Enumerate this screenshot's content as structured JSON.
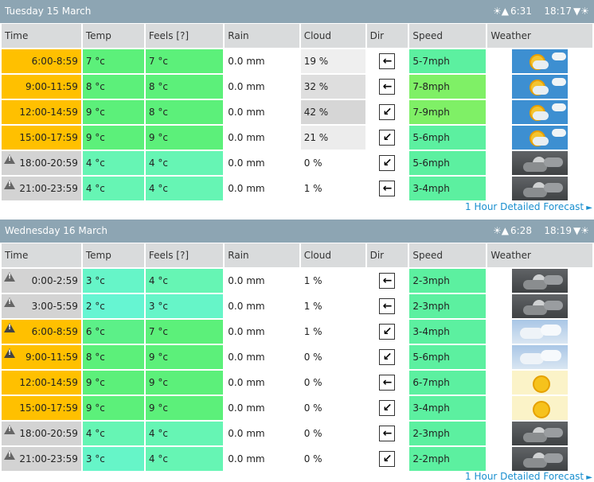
{
  "colors": {
    "header_bg": "#8da5b3",
    "time_orange": "#ffc000",
    "time_grey": "#d3d3d3",
    "temp_green_mid": "#5cf07a",
    "temp_green_light": "#66f0a8",
    "temp_teal": "#66f5c8",
    "cloud_light": "#eeeeee",
    "cloud_mid": "#dcdcdc",
    "speed_green": "#5cf0a0",
    "speed_lime": "#7ff066",
    "link_blue": "#1a8fcf"
  },
  "columns": [
    "Time",
    "Temp",
    "Feels [?]",
    "Rain",
    "Cloud",
    "Dir",
    "Speed",
    "Weather"
  ],
  "link_text": "1 Hour Detailed Forecast",
  "days": [
    {
      "title": "Tuesday 15 March",
      "sunrise": "6:31",
      "sunset": "18:17",
      "rows": [
        {
          "time": "6:00-8:59",
          "time_style": "orange",
          "warn": false,
          "temp": "7 °c",
          "temp_color": "#5cf07a",
          "feels": "7 °c",
          "feels_color": "#5cf07a",
          "rain": "0.0 mm",
          "cloud": "19 %",
          "cloud_color": "#efefef",
          "dir": "←",
          "speed": "5-7mph",
          "speed_color": "#5cf0a0",
          "weather": "sunny-cloud"
        },
        {
          "time": "9:00-11:59",
          "time_style": "orange",
          "warn": false,
          "temp": "8 °c",
          "temp_color": "#5cf07a",
          "feels": "8 °c",
          "feels_color": "#5cf07a",
          "rain": "0.0 mm",
          "cloud": "32 %",
          "cloud_color": "#dedede",
          "dir": "←",
          "speed": "7-8mph",
          "speed_color": "#7ff066",
          "weather": "sunny-cloud"
        },
        {
          "time": "12:00-14:59",
          "time_style": "orange",
          "warn": false,
          "temp": "9 °c",
          "temp_color": "#5cf07a",
          "feels": "8 °c",
          "feels_color": "#5cf07a",
          "rain": "0.0 mm",
          "cloud": "42 %",
          "cloud_color": "#d6d6d6",
          "dir": "↙",
          "speed": "7-9mph",
          "speed_color": "#7ff066",
          "weather": "sunny-cloud"
        },
        {
          "time": "15:00-17:59",
          "time_style": "orange",
          "warn": false,
          "temp": "9 °c",
          "temp_color": "#5cf07a",
          "feels": "9 °c",
          "feels_color": "#5cf07a",
          "rain": "0.0 mm",
          "cloud": "21 %",
          "cloud_color": "#ececec",
          "dir": "↙",
          "speed": "5-6mph",
          "speed_color": "#5cf0a0",
          "weather": "sunny-cloud"
        },
        {
          "time": "18:00-20:59",
          "time_style": "grey",
          "warn": true,
          "temp": "4 °c",
          "temp_color": "#66f5b4",
          "feels": "4 °c",
          "feels_color": "#66f5b4",
          "rain": "0.0 mm",
          "cloud": "0 %",
          "cloud_color": "#ffffff",
          "dir": "↙",
          "speed": "5-6mph",
          "speed_color": "#5cf0a0",
          "weather": "night-cloud"
        },
        {
          "time": "21:00-23:59",
          "time_style": "grey",
          "warn": true,
          "temp": "4 °c",
          "temp_color": "#66f5b4",
          "feels": "4 °c",
          "feels_color": "#66f5b4",
          "rain": "0.0 mm",
          "cloud": "1 %",
          "cloud_color": "#ffffff",
          "dir": "←",
          "speed": "3-4mph",
          "speed_color": "#5cf0a0",
          "weather": "night-cloud"
        }
      ]
    },
    {
      "title": "Wednesday 16 March",
      "sunrise": "6:28",
      "sunset": "18:19",
      "rows": [
        {
          "time": "0:00-2:59",
          "time_style": "grey",
          "warn": true,
          "temp": "3 °c",
          "temp_color": "#66f5c8",
          "feels": "4 °c",
          "feels_color": "#66f5b4",
          "rain": "0.0 mm",
          "cloud": "1 %",
          "cloud_color": "#ffffff",
          "dir": "←",
          "speed": "2-3mph",
          "speed_color": "#5cf0a0",
          "weather": "night-cloud"
        },
        {
          "time": "3:00-5:59",
          "time_style": "grey",
          "warn": true,
          "temp": "2 °c",
          "temp_color": "#66f5d2",
          "feels": "3 °c",
          "feels_color": "#66f5c8",
          "rain": "0.0 mm",
          "cloud": "1 %",
          "cloud_color": "#ffffff",
          "dir": "←",
          "speed": "2-3mph",
          "speed_color": "#5cf0a0",
          "weather": "night-cloud"
        },
        {
          "time": "6:00-8:59",
          "time_style": "orange",
          "warn": true,
          "temp": "6 °c",
          "temp_color": "#5cf088",
          "feels": "7 °c",
          "feels_color": "#5cf07a",
          "rain": "0.0 mm",
          "cloud": "1 %",
          "cloud_color": "#ffffff",
          "dir": "↙",
          "speed": "3-4mph",
          "speed_color": "#5cf0a0",
          "weather": "cloudy"
        },
        {
          "time": "9:00-11:59",
          "time_style": "orange",
          "warn": true,
          "temp": "8 °c",
          "temp_color": "#5cf07a",
          "feels": "9 °c",
          "feels_color": "#5cf07a",
          "rain": "0.0 mm",
          "cloud": "0 %",
          "cloud_color": "#ffffff",
          "dir": "↙",
          "speed": "5-6mph",
          "speed_color": "#5cf0a0",
          "weather": "cloudy"
        },
        {
          "time": "12:00-14:59",
          "time_style": "orange",
          "warn": false,
          "temp": "9 °c",
          "temp_color": "#5cf07a",
          "feels": "9 °c",
          "feels_color": "#5cf07a",
          "rain": "0.0 mm",
          "cloud": "0 %",
          "cloud_color": "#ffffff",
          "dir": "←",
          "speed": "6-7mph",
          "speed_color": "#5cf0a0",
          "weather": "sun"
        },
        {
          "time": "15:00-17:59",
          "time_style": "orange",
          "warn": false,
          "temp": "9 °c",
          "temp_color": "#5cf07a",
          "feels": "9 °c",
          "feels_color": "#5cf07a",
          "rain": "0.0 mm",
          "cloud": "0 %",
          "cloud_color": "#ffffff",
          "dir": "↙",
          "speed": "3-4mph",
          "speed_color": "#5cf0a0",
          "weather": "sun"
        },
        {
          "time": "18:00-20:59",
          "time_style": "grey",
          "warn": true,
          "temp": "4 °c",
          "temp_color": "#66f5b4",
          "feels": "4 °c",
          "feels_color": "#66f5b4",
          "rain": "0.0 mm",
          "cloud": "0 %",
          "cloud_color": "#ffffff",
          "dir": "←",
          "speed": "2-3mph",
          "speed_color": "#5cf0a0",
          "weather": "night-cloud"
        },
        {
          "time": "21:00-23:59",
          "time_style": "grey",
          "warn": true,
          "temp": "3 °c",
          "temp_color": "#66f5c8",
          "feels": "4 °c",
          "feels_color": "#66f5b4",
          "rain": "0.0 mm",
          "cloud": "0 %",
          "cloud_color": "#ffffff",
          "dir": "↙",
          "speed": "2-2mph",
          "speed_color": "#5cf0a0",
          "weather": "night-cloud"
        }
      ]
    }
  ]
}
